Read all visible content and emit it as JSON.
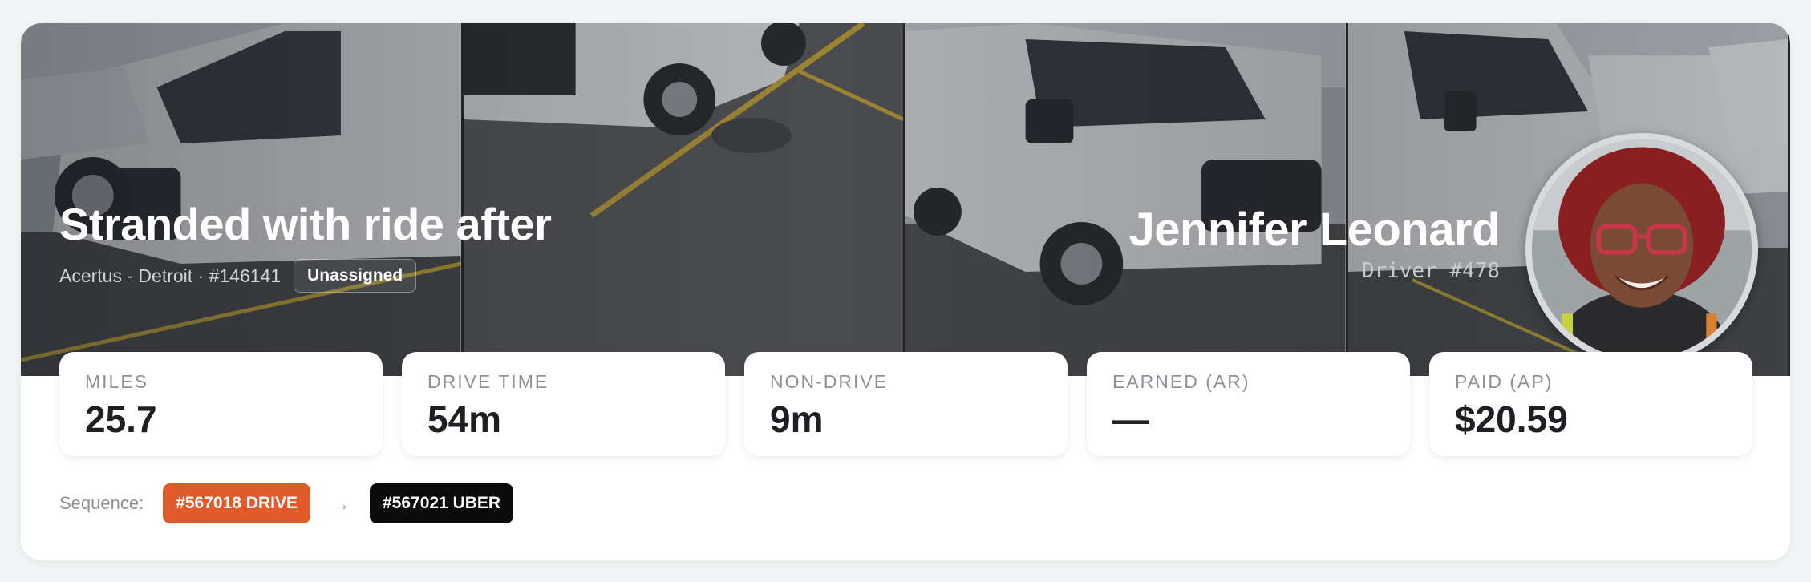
{
  "trip": {
    "title": "Stranded with ride after",
    "client_and_id": "Acertus - Detroit · #146141",
    "status": "Unassigned"
  },
  "driver": {
    "name": "Jennifer Leonard",
    "id_label": "Driver #478"
  },
  "stats": [
    {
      "label": "MILES",
      "value": "25.7"
    },
    {
      "label": "DRIVE TIME",
      "value": "54m"
    },
    {
      "label": "NON-DRIVE",
      "value": "9m"
    },
    {
      "label": "EARNED (AR)",
      "value": "—"
    },
    {
      "label": "PAID (AP)",
      "value": "$20.59"
    }
  ],
  "sequence": {
    "label": "Sequence:",
    "arrow": "→",
    "items": [
      {
        "text": "#567018 DRIVE",
        "color": "#e05a2b"
      },
      {
        "text": "#567021 UBER",
        "color": "#0b0b0b"
      }
    ]
  },
  "colors": {
    "drive_chip": "#e05a2b",
    "uber_chip": "#0b0b0b",
    "card_bg": "#ffffff",
    "page_bg": "#f1f4f5"
  }
}
